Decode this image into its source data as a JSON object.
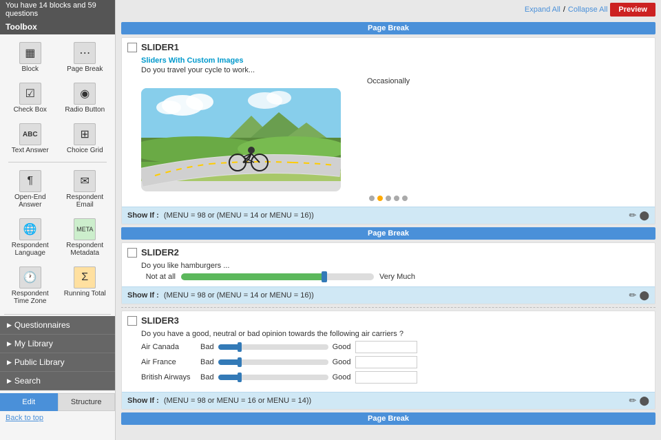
{
  "info_bar": {
    "text": "You have 14 blocks and 59 questions"
  },
  "sidebar": {
    "header": "Toolbox",
    "tools": [
      {
        "id": "block",
        "label": "Block",
        "icon": "▦"
      },
      {
        "id": "page-break",
        "label": "Page Break",
        "icon": "⋯"
      },
      {
        "id": "check-box",
        "label": "Check Box",
        "icon": "☑"
      },
      {
        "id": "radio-button",
        "label": "Radio Button",
        "icon": "◉"
      },
      {
        "id": "text-answer",
        "label": "Text Answer",
        "icon": "ABC"
      },
      {
        "id": "choice-grid",
        "label": "Choice Grid",
        "icon": "⊞"
      },
      {
        "id": "open-end-answer",
        "label": "Open-End Answer",
        "icon": "¶"
      },
      {
        "id": "respondent-email",
        "label": "Respondent Email",
        "icon": "✉"
      },
      {
        "id": "respondent-language",
        "label": "Respondent Language",
        "icon": "🌐"
      },
      {
        "id": "respondent-metadata",
        "label": "Respondent Metadata",
        "icon": "⊕"
      },
      {
        "id": "respondent-time-zone",
        "label": "Respondent Time Zone",
        "icon": "🕐"
      },
      {
        "id": "running-total",
        "label": "Running Total",
        "icon": "Σ"
      }
    ],
    "nav_items": [
      {
        "id": "questionnaires",
        "label": "Questionnaires"
      },
      {
        "id": "my-library",
        "label": "My Library"
      },
      {
        "id": "public-library",
        "label": "Public Library"
      },
      {
        "id": "search",
        "label": "Search"
      }
    ],
    "tabs": [
      {
        "id": "edit",
        "label": "Edit",
        "active": true
      },
      {
        "id": "structure",
        "label": "Structure",
        "active": false
      }
    ],
    "back_to_top": "Back to top"
  },
  "top_bar": {
    "expand_all": "Expand All",
    "separator": "/",
    "collapse_all": "Collapse All",
    "preview_btn": "Preview"
  },
  "page_break_label": "Page Break",
  "questions": [
    {
      "id": "slider1",
      "title": "SLIDER1",
      "subtitle": "Sliders With Custom Images",
      "desc": "Do you travel your cycle to work...",
      "type": "image-slider",
      "current_value": "Occasionally",
      "show_if": "(MENU = 98 or (MENU = 14 or MENU = 16))"
    },
    {
      "id": "slider2",
      "title": "SLIDER2",
      "desc": "Do you like hamburgers ...",
      "type": "slider",
      "label_left": "Not at all",
      "label_right": "Very Much",
      "show_if": "(MENU = 98 or (MENU = 14 or MENU = 16))"
    },
    {
      "id": "slider3",
      "title": "SLIDER3",
      "desc": "Do you have a good, neutral or bad opinion towards the following air carriers ?",
      "type": "multi-slider",
      "rows": [
        {
          "airline": "Air Canada",
          "bad": "Bad",
          "good": "Good"
        },
        {
          "airline": "Air France",
          "bad": "Bad",
          "good": "Good"
        },
        {
          "airline": "British Airways",
          "bad": "Bad",
          "good": "Good"
        }
      ],
      "show_if": "(MENU = 98 or MENU = 16 or MENU = 14))"
    }
  ],
  "show_if_label": "Show If :"
}
